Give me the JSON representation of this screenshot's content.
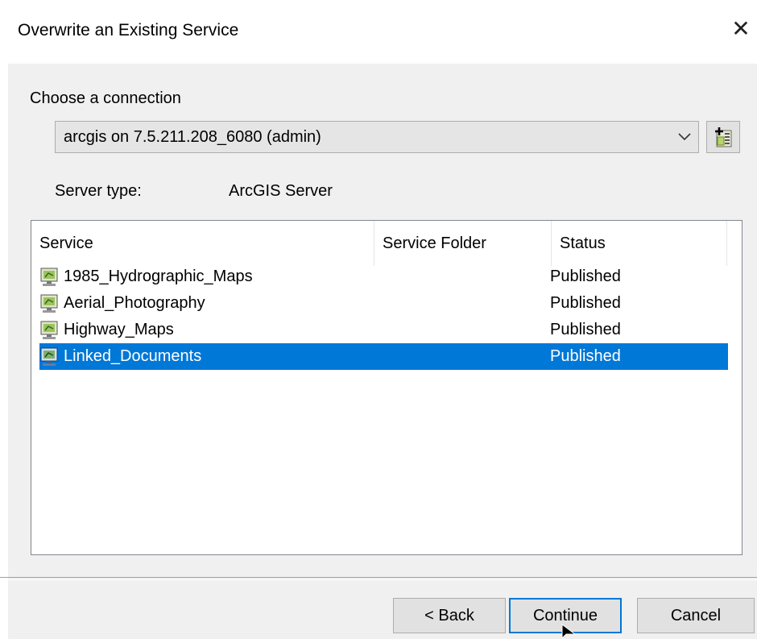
{
  "window": {
    "title": "Overwrite an Existing Service",
    "close_glyph": "✕"
  },
  "connection": {
    "label": "Choose a connection",
    "selected": "arcgis on 7.5.211.208_6080 (admin)",
    "add_icon": "add-connection-icon"
  },
  "server": {
    "type_label": "Server type:",
    "type_value": "ArcGIS Server"
  },
  "services": {
    "columns": [
      "Service",
      "Service Folder",
      "Status"
    ],
    "rows": [
      {
        "name": "1985_Hydrographic_Maps",
        "folder": "",
        "status": "Published",
        "selected": false
      },
      {
        "name": "Aerial_Photography",
        "folder": "",
        "status": "Published",
        "selected": false
      },
      {
        "name": "Highway_Maps",
        "folder": "",
        "status": "Published",
        "selected": false
      },
      {
        "name": "Linked_Documents",
        "folder": "",
        "status": "Published",
        "selected": true
      }
    ]
  },
  "buttons": {
    "back": "< Back",
    "continue": "Continue",
    "cancel": "Cancel"
  },
  "colors": {
    "selection": "#0078d7",
    "dialog_bg": "#f0f0f0"
  }
}
